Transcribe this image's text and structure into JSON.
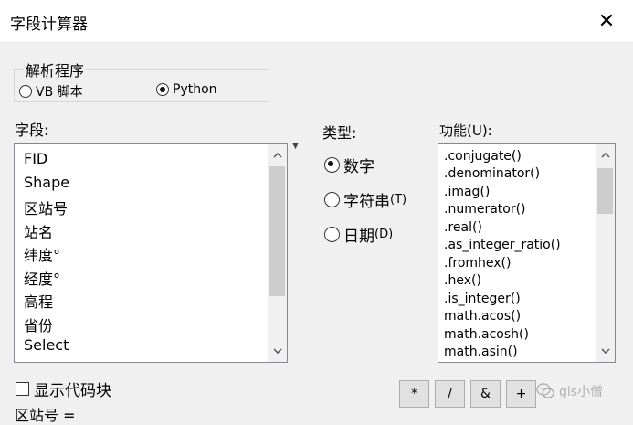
{
  "window": {
    "title": "字段计算器",
    "close_glyph": "✕"
  },
  "parser": {
    "legend": "解析程序",
    "options": [
      {
        "label": "VB 脚本",
        "selected": false
      },
      {
        "label": "Python",
        "selected": true
      }
    ]
  },
  "fields": {
    "label": "字段:",
    "items": [
      "FID",
      "Shape",
      "区站号",
      "站名",
      "纬度°",
      "经度°",
      "高程",
      "省份",
      "Select"
    ]
  },
  "types": {
    "label": "类型:",
    "options": [
      {
        "label": "数字",
        "selected": true
      },
      {
        "label": "字符串",
        "hotkey": "(T)",
        "selected": false
      },
      {
        "label": "日期",
        "hotkey": "(D)",
        "selected": false
      }
    ]
  },
  "functions": {
    "label": "功能(U):",
    "items": [
      ".conjugate()",
      ".denominator()",
      ".imag()",
      ".numerator()",
      ".real()",
      ".as_integer_ratio()",
      ".fromhex()",
      ".hex()",
      ".is_integer()",
      "math.acos()",
      "math.acosh()",
      "math.asin()"
    ]
  },
  "codeblock": {
    "label": "显示代码块",
    "checked": false
  },
  "expression": {
    "label": "区站号 ="
  },
  "operators": [
    "*",
    "/",
    "&",
    "+"
  ],
  "watermark": {
    "text": "gis小僧"
  },
  "icons": {
    "close": "close-icon",
    "scroll_up": "chevron-up-icon",
    "scroll_down": "chevron-down-icon",
    "dropdown": "triangle-down-icon",
    "watermark": "wechat-icon"
  }
}
